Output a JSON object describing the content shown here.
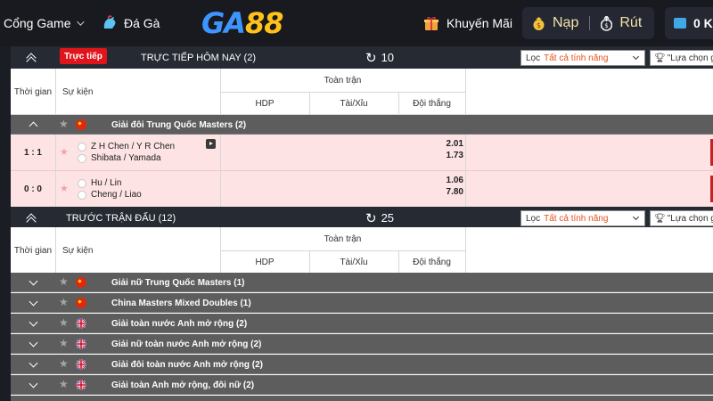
{
  "nav": {
    "portal_label": "Cổng Game",
    "cockfight_label": "Đá Gà",
    "logo_part1": "GA",
    "logo_part2": "88",
    "promo_label": "Khuyến Mãi",
    "deposit_label": "Nạp",
    "withdraw_label": "Rút",
    "balance_label": "0 K"
  },
  "live_section": {
    "badge": "Trực tiếp",
    "title": "TRỰC TIẾP HÔM NAY (2)",
    "count": "10",
    "filter_prefix": "Lọc",
    "filter_value": "Tất cả tính năng",
    "choose_label": "\"Lựa chọn gi"
  },
  "table_header": {
    "time": "Thời gian",
    "event": "Sự kiện",
    "fulltime": "Toàn trận",
    "hdp": "HDP",
    "over_under": "Tài/Xỉu",
    "winner": "Đội thắng"
  },
  "live_league": {
    "name": "Giải đôi Trung Quốc Masters (2)",
    "flag": "cn"
  },
  "matches": [
    {
      "score": "1 : 1",
      "home": "Z H Chen / Y R Chen",
      "away": "Shibata / Yamada",
      "odd_home": "2.01",
      "odd_away": "1.73",
      "has_stream": true
    },
    {
      "score": "0 : 0",
      "home": "Hu / Lin",
      "away": "Cheng / Liao",
      "odd_home": "1.06",
      "odd_away": "7.80",
      "has_stream": false
    }
  ],
  "pre_section": {
    "title": "TRƯỚC TRẬN ĐẤU (12)",
    "count": "25",
    "filter_prefix": "Lọc",
    "filter_value": "Tất cả tính năng",
    "choose_label": "\"Lựa chọn gi"
  },
  "leagues": [
    {
      "name": "Giải nữ Trung Quốc Masters (1)",
      "flag": "cn"
    },
    {
      "name": "China Masters Mixed Doubles (1)",
      "flag": "cn"
    },
    {
      "name": "Giải toàn nước Anh mở rộng (2)",
      "flag": "uk"
    },
    {
      "name": "Giải nữ toàn nước Anh mở rộng (2)",
      "flag": "uk"
    },
    {
      "name": "Giải đôi toàn nước Anh mở rộng (2)",
      "flag": "uk"
    },
    {
      "name": "Giải toàn Anh mở rộng, đôi nữ (2)",
      "flag": "uk"
    }
  ],
  "icons": {
    "chevron": "chevron-down-icon",
    "rooster": "rooster-icon",
    "gift": "gift-icon",
    "coin": "coin-icon",
    "withdraw": "withdraw-icon",
    "wallet": "wallet-icon",
    "refresh": "refresh-icon",
    "trophy": "trophy-icon",
    "star": "star-icon",
    "play": "play-icon"
  },
  "colors": {
    "live_badge": "#e0151b",
    "match_bg": "#fde3e3",
    "league_bg": "#5d5d5d",
    "bar_bg": "#262a33",
    "filter_value": "#e8501a",
    "logo_blue": "#3d96ff",
    "logo_gold": "#ffc21a"
  }
}
